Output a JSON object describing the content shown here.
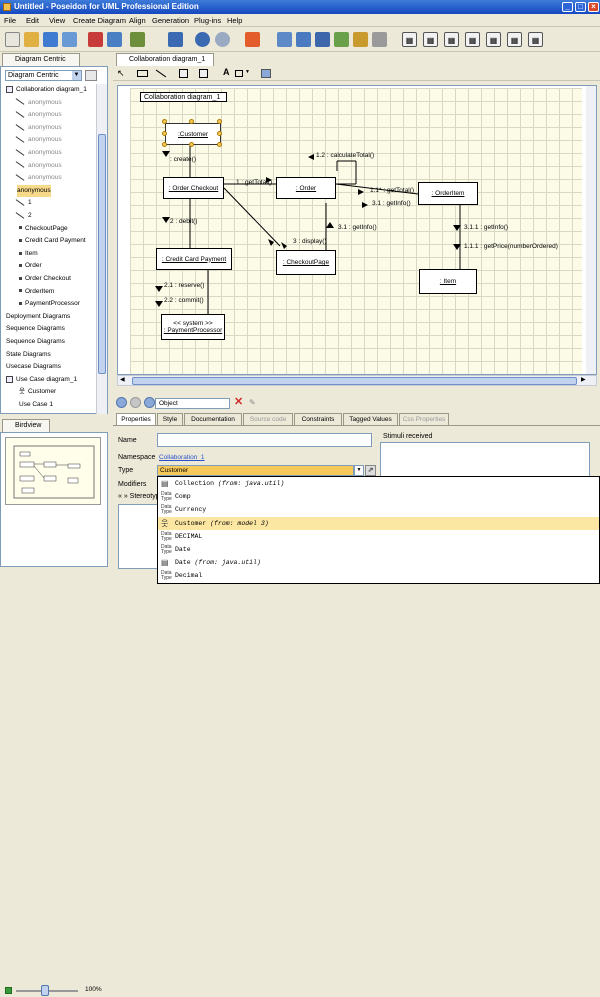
{
  "app": {
    "title": "Untitled - Poseidon for UML Professional Edition"
  },
  "menu": [
    "File",
    "Edit",
    "View",
    "Create Diagram",
    "Align",
    "Generation",
    "Plug-ins",
    "Help"
  ],
  "left_panel": {
    "tab": "Diagram Centric",
    "combo_value": "Diagram Centric",
    "tree": [
      {
        "label": "Collaboration diagram_1",
        "style": "root"
      },
      {
        "label": "anonymous",
        "style": "gray-link"
      },
      {
        "label": "anonymous",
        "style": "gray-link"
      },
      {
        "label": "anonymous",
        "style": "gray-link"
      },
      {
        "label": "anonymous",
        "style": "gray-link"
      },
      {
        "label": "anonymous",
        "style": "gray-link"
      },
      {
        "label": "anonymous",
        "style": "gray-link"
      },
      {
        "label": "anonymous",
        "style": "gray-link"
      },
      {
        "label": "anonymous",
        "style": "selected"
      },
      {
        "label": "1",
        "style": "link"
      },
      {
        "label": "2",
        "style": "link"
      },
      {
        "label": "CheckoutPage",
        "style": "obj"
      },
      {
        "label": "Credit Card Payment",
        "style": "obj"
      },
      {
        "label": "Item",
        "style": "obj"
      },
      {
        "label": "Order",
        "style": "obj"
      },
      {
        "label": "Order Checkout",
        "style": "obj"
      },
      {
        "label": "OrderItem",
        "style": "obj"
      },
      {
        "label": "PaymentProcessor",
        "style": "obj"
      },
      {
        "label": "Deployment Diagrams",
        "style": "cat"
      },
      {
        "label": "Sequence Diagrams",
        "style": "cat"
      },
      {
        "label": "Sequence Diagrams",
        "style": "cat"
      },
      {
        "label": "State Diagrams",
        "style": "cat"
      },
      {
        "label": "Usecase Diagrams",
        "style": "cat"
      },
      {
        "label": "Use Case diagram_1",
        "style": "root"
      },
      {
        "label": "Customer",
        "style": "actor"
      },
      {
        "label": "Use Case 1",
        "style": "cut"
      }
    ]
  },
  "birdview": {
    "tab": "Birdview",
    "zoom": "100%"
  },
  "diagram": {
    "tab": "Collaboration diagram_1",
    "label": "Collaboration diagram_1",
    "objects": {
      "customer": ":Customer",
      "order_checkout": ": Order Checkout",
      "order": ": Order",
      "orderitem": ": OrderItem",
      "credit_card_payment": ": Credit Card Payment",
      "checkoutpage": ": CheckoutPage",
      "item": ": Item",
      "payment_stereotype": "<< system >>",
      "payment_processor": ": PaymentProcessor"
    },
    "messages": {
      "create": ": create()",
      "calculate": "1.2 : calculateTotal()",
      "gettotal": "1 : getTotal()",
      "gettotal2": "1.1* : getTotal()",
      "getinfo": "3.1 : getInfo()",
      "debit": "2 : debit()",
      "display": "3 : display()",
      "getinfo2": "3.1 : getInfo()",
      "getinfo3": "3.1.1 : getInfo()",
      "getprice": "1.1.1 : getPrice(numberOrdered)",
      "reserve": "2.1 : reserve()",
      "commit": "2.2 : commit()"
    }
  },
  "nav": {
    "object_field": "Object"
  },
  "props": {
    "tabs": [
      "Properties",
      "Style",
      "Documentation",
      "Source code",
      "Constraints",
      "Tagged Values",
      "Css Properties"
    ],
    "name_label": "Name",
    "namespace_label": "Namespace",
    "namespace_value": "Collaboration_1",
    "type_label": "Type",
    "type_value": "Customer",
    "modifiers_label": "Modifiers",
    "stereotype_label": "« » Stereotype",
    "stimuli_label": "Stimuli received"
  },
  "dropdown": [
    {
      "name": "Collection",
      "from": "(from: java.util)"
    },
    {
      "name": "Comp",
      "from": ""
    },
    {
      "name": "Currency",
      "from": ""
    },
    {
      "name": "Customer",
      "from": "(from: model 3)"
    },
    {
      "name": "DECIMAL",
      "from": ""
    },
    {
      "name": "Date",
      "from": ""
    },
    {
      "name": "Date",
      "from": "(from: java.util)"
    },
    {
      "name": "Decimal",
      "from": ""
    }
  ]
}
